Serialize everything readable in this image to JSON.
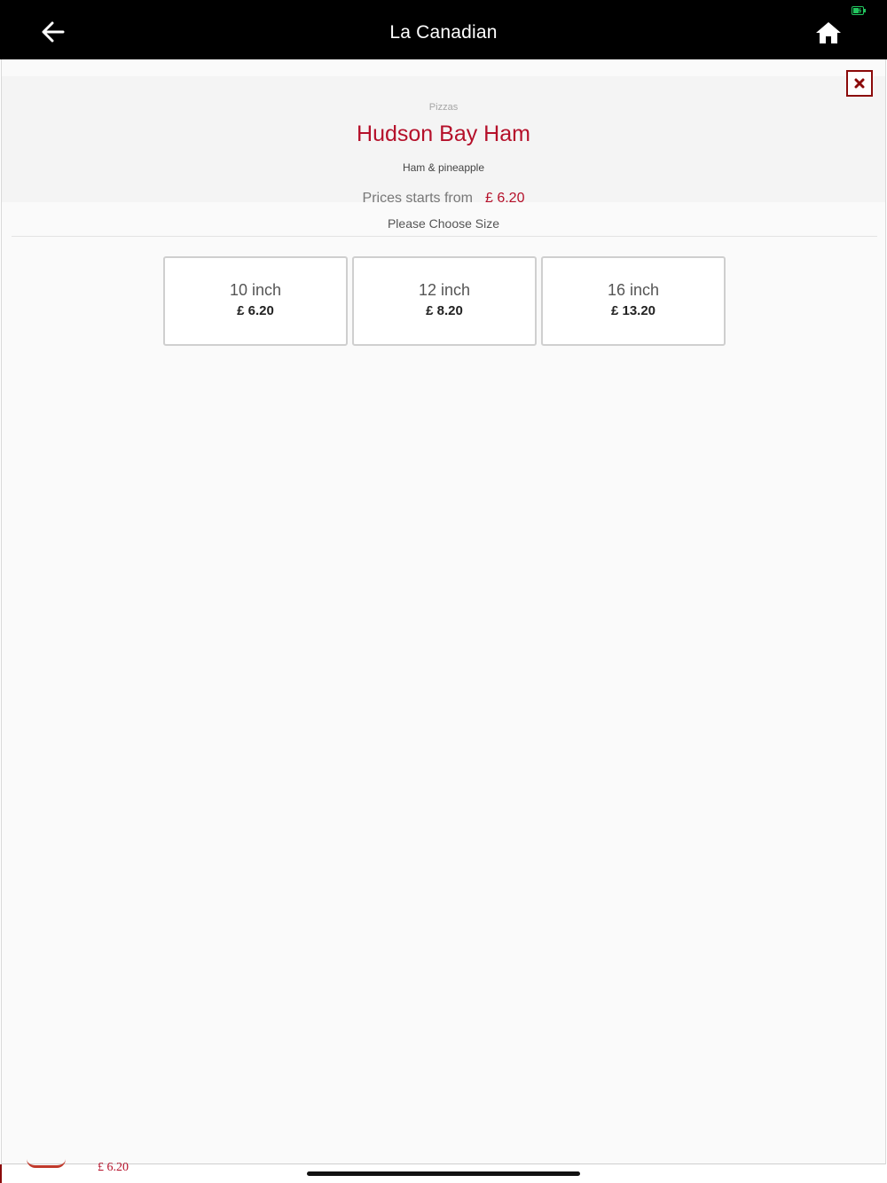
{
  "header": {
    "title": "La Canadian",
    "back_icon": "arrow-left-icon",
    "home_icon": "home-icon",
    "battery_icon": "battery-charging-icon",
    "battery_color": "#22c55e"
  },
  "product": {
    "category": "Pizzas",
    "name": "Hudson Bay Ham",
    "description": "Ham & pineapple",
    "price_label": "Prices starts from",
    "price_value": "£ 6.20"
  },
  "close_icon": "close-icon",
  "size_section": {
    "label": "Please Choose Size",
    "options": [
      {
        "name": "10 inch",
        "price": "£ 6.20"
      },
      {
        "name": "12 inch",
        "price": "£ 8.20"
      },
      {
        "name": "16 inch",
        "price": "£ 13.20"
      }
    ]
  },
  "background_item": {
    "price": "£ 6.20"
  },
  "colors": {
    "accent": "#b5102a",
    "close_border": "#8b0a0a",
    "header_bg": "#000000"
  }
}
